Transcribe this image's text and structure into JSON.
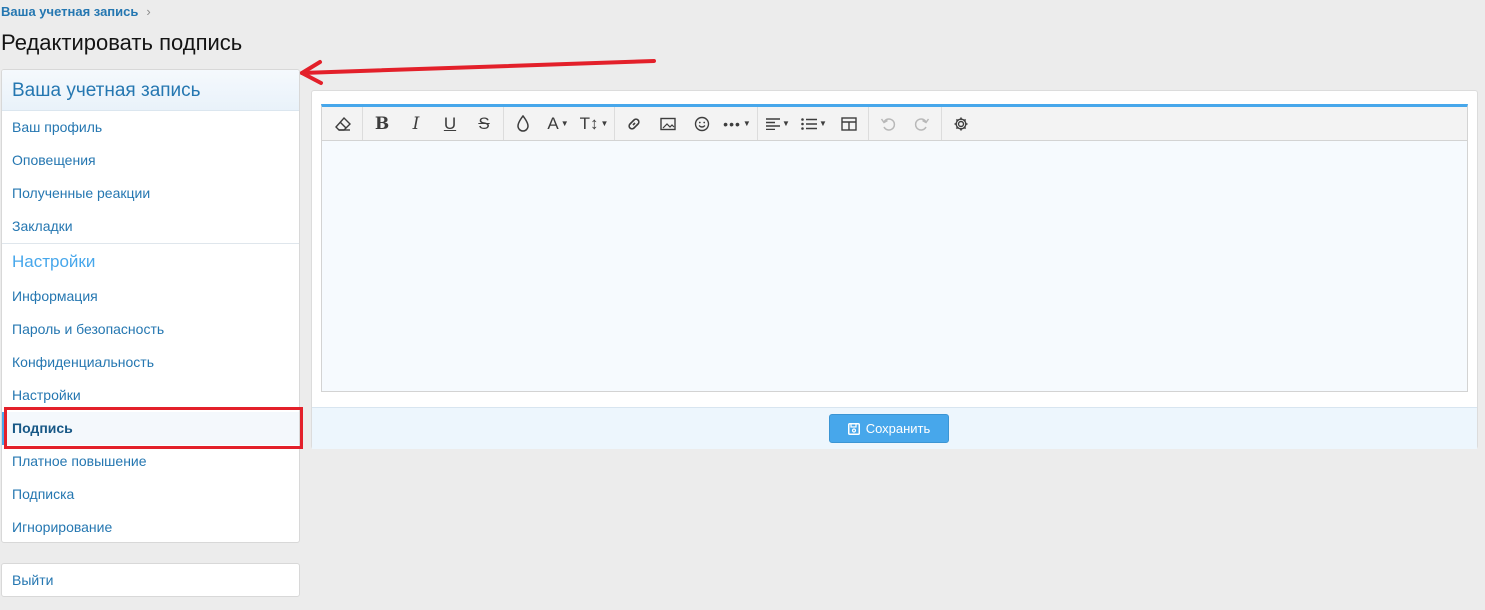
{
  "breadcrumb": {
    "item": "Ваша учетная запись",
    "chevron": "›"
  },
  "page_title": "Редактировать подпись",
  "sidebar": {
    "header": "Ваша учетная запись",
    "account_items": [
      {
        "label": "Ваш профиль"
      },
      {
        "label": "Оповещения"
      },
      {
        "label": "Полученные реакции"
      },
      {
        "label": "Закладки"
      }
    ],
    "settings_header": "Настройки",
    "settings_items": [
      {
        "label": "Информация"
      },
      {
        "label": "Пароль и безопасность"
      },
      {
        "label": "Конфиденциальность"
      },
      {
        "label": "Настройки"
      },
      {
        "label": "Подпись",
        "active": true
      },
      {
        "label": "Платное повышение"
      },
      {
        "label": "Подписка"
      },
      {
        "label": "Игнорирование"
      }
    ],
    "logout": "Выйти"
  },
  "editor": {
    "toolbar": [
      "eraser-icon",
      "bold-icon",
      "italic-icon",
      "underline-icon",
      "strikethrough-icon",
      "text-color-icon",
      "font-family-icon",
      "font-size-icon",
      "link-icon",
      "image-icon",
      "smiley-icon",
      "more-icon",
      "align-icon",
      "list-icon",
      "table-icon",
      "undo-icon",
      "redo-icon",
      "settings-icon"
    ],
    "content": ""
  },
  "save_button": {
    "label": "Сохранить",
    "icon": "floppy-disk-icon"
  },
  "colors": {
    "link": "#2577b1",
    "accent": "#47a7eb",
    "annotation_red": "#e3202a",
    "background": "#ececec"
  }
}
